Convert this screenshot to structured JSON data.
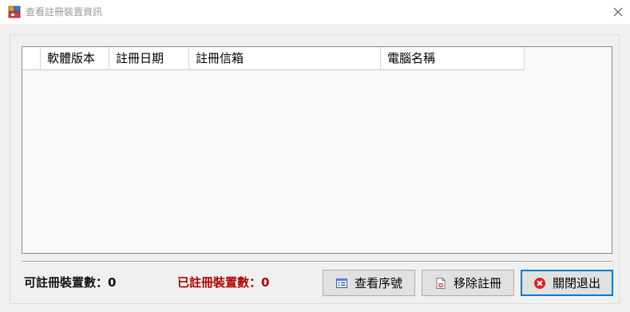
{
  "window": {
    "title": "查看註冊裝置資訊",
    "icon": "app-window-icon",
    "close_icon": "close-icon"
  },
  "grid": {
    "columns": [
      {
        "label": ""
      },
      {
        "label": "軟體版本"
      },
      {
        "label": "註冊日期"
      },
      {
        "label": "註冊信箱"
      },
      {
        "label": "電腦名稱"
      }
    ],
    "rows": []
  },
  "status": {
    "available_label": "可註冊裝置數：0",
    "registered_label": "已註冊裝置數：0",
    "registered_color": "#b10000"
  },
  "buttons": {
    "view_serial": {
      "label": "查看序號",
      "icon": "serial-list-icon"
    },
    "remove_registration": {
      "label": "移除註冊",
      "icon": "remove-document-icon"
    },
    "close_exit": {
      "label": "關閉退出",
      "icon": "close-circle-icon"
    }
  },
  "colors": {
    "accent": "#0078d7",
    "close_icon_red": "#d9262b"
  }
}
